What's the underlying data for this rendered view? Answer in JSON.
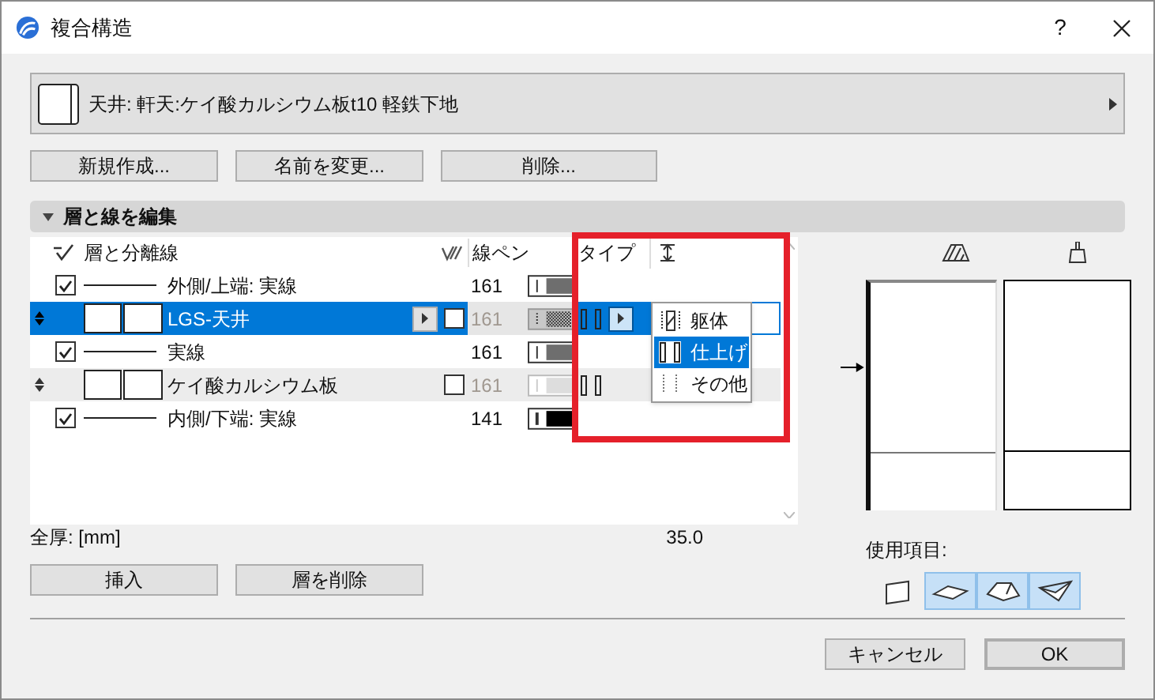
{
  "window": {
    "title": "複合構造",
    "help": "?"
  },
  "selector": {
    "label": "天井: 軒天:ケイ酸カルシウム板t10 軽鉄下地"
  },
  "top_buttons": [
    "新規作成...",
    "名前を変更...",
    "削除..."
  ],
  "section": {
    "title": "層と線を編集",
    "expanded": true
  },
  "table": {
    "columns": [
      "層と分離線",
      "線ペン",
      "タイプ"
    ],
    "rows": [
      {
        "kind": "line",
        "checked": true,
        "selected": false,
        "name": "外側/上端: 実線",
        "pen": "161",
        "color": "#6e6e6e"
      },
      {
        "kind": "skin",
        "selected": true,
        "name": "LGS-天井",
        "pen": "161"
      },
      {
        "kind": "line",
        "checked": true,
        "selected": false,
        "name": "実線",
        "pen": "161",
        "color": "#6e6e6e"
      },
      {
        "kind": "skin",
        "selected": false,
        "name": "ケイ酸カルシウム板",
        "pen": "161"
      },
      {
        "kind": "line",
        "checked": true,
        "selected": false,
        "name": "内側/下端: 実線",
        "pen": "141",
        "color": "#000000"
      }
    ]
  },
  "type_menu": [
    {
      "kind": "core",
      "label": "躯体",
      "selected": false
    },
    {
      "kind": "finish",
      "label": "仕上げ",
      "selected": true
    },
    {
      "kind": "other",
      "label": "その他",
      "selected": false
    }
  ],
  "total": {
    "label": "全厚: [mm]",
    "value": "35.0"
  },
  "usage": {
    "label": "使用項目:",
    "items": [
      {
        "kind": "wall",
        "selected": false
      },
      {
        "kind": "slab",
        "selected": true
      },
      {
        "kind": "roof",
        "selected": true
      },
      {
        "kind": "shell",
        "selected": true
      }
    ]
  },
  "bottom_buttons": [
    "挿入",
    "層を削除"
  ],
  "footer_buttons": [
    {
      "label": "キャンセル",
      "default": false
    },
    {
      "label": "OK",
      "default": true
    }
  ]
}
